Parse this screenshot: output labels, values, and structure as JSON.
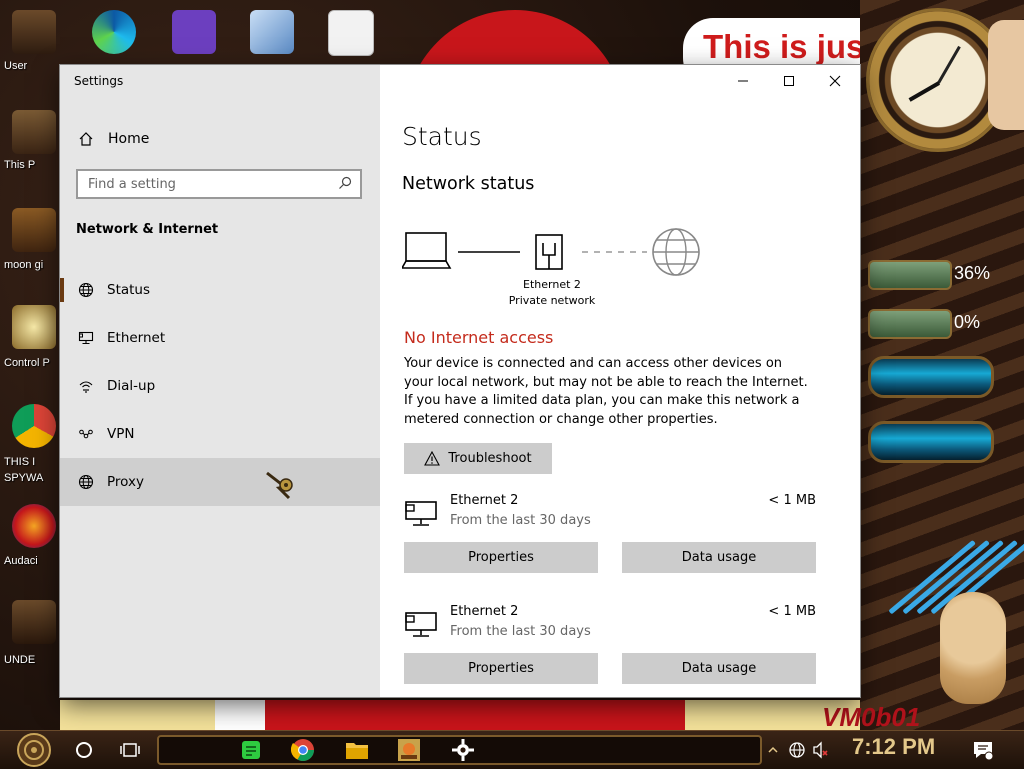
{
  "window": {
    "title": "Settings",
    "controls": {
      "minimize": "—",
      "maximize": "☐",
      "close": "✕"
    }
  },
  "sidebar": {
    "home_label": "Home",
    "search": {
      "placeholder": "Find a setting"
    },
    "section_title": "Network & Internet",
    "items": [
      {
        "label": "Status",
        "icon": "globe-icon",
        "state": "selected"
      },
      {
        "label": "Ethernet",
        "icon": "ethernet-icon",
        "state": ""
      },
      {
        "label": "Dial-up",
        "icon": "dialup-icon",
        "state": ""
      },
      {
        "label": "VPN",
        "icon": "vpn-icon",
        "state": ""
      },
      {
        "label": "Proxy",
        "icon": "globe-icon",
        "state": "hover"
      }
    ]
  },
  "main": {
    "page_title": "Status",
    "network_status_title": "Network status",
    "diagram": {
      "adapter_name": "Ethernet 2",
      "network_type": "Private network"
    },
    "warning_title": "No Internet access",
    "warning_body": "Your device is connected and can access other devices on your local network, but may not be able to reach the Internet. If you have a limited data plan, you can make this network a metered connection or change other properties.",
    "troubleshoot_label": "Troubleshoot",
    "connections": [
      {
        "name": "Ethernet 2",
        "subtitle": "From the last 30 days",
        "usage": "< 1 MB",
        "properties_label": "Properties",
        "data_usage_label": "Data usage"
      },
      {
        "name": "Ethernet 2",
        "subtitle": "From the last 30 days",
        "usage": "< 1 MB",
        "properties_label": "Properties",
        "data_usage_label": "Data usage"
      }
    ]
  },
  "desktop": {
    "banner_text": "This is jus",
    "watermark": "VM0b01",
    "gauges": [
      {
        "label": "36%"
      },
      {
        "label": "0%"
      }
    ],
    "icons": [
      {
        "label": "User"
      },
      {
        "label": "This P"
      },
      {
        "label": "moon gi"
      },
      {
        "label": "Control P"
      },
      {
        "label": "THIS I"
      },
      {
        "label": "SPYWA"
      },
      {
        "label": "Audaci"
      },
      {
        "label": "UNDE"
      }
    ]
  },
  "taskbar": {
    "clock": "7:12 PM",
    "apps": [
      "start-button",
      "cortana-icon",
      "task-view-icon",
      "notes-app",
      "chrome",
      "file-explorer",
      "game-app",
      "settings-gear"
    ]
  },
  "colors": {
    "accent": "#6b3a12",
    "warning": "#c42b1c",
    "button": "#cccccc",
    "sidebar_bg": "#e6e6e6"
  }
}
